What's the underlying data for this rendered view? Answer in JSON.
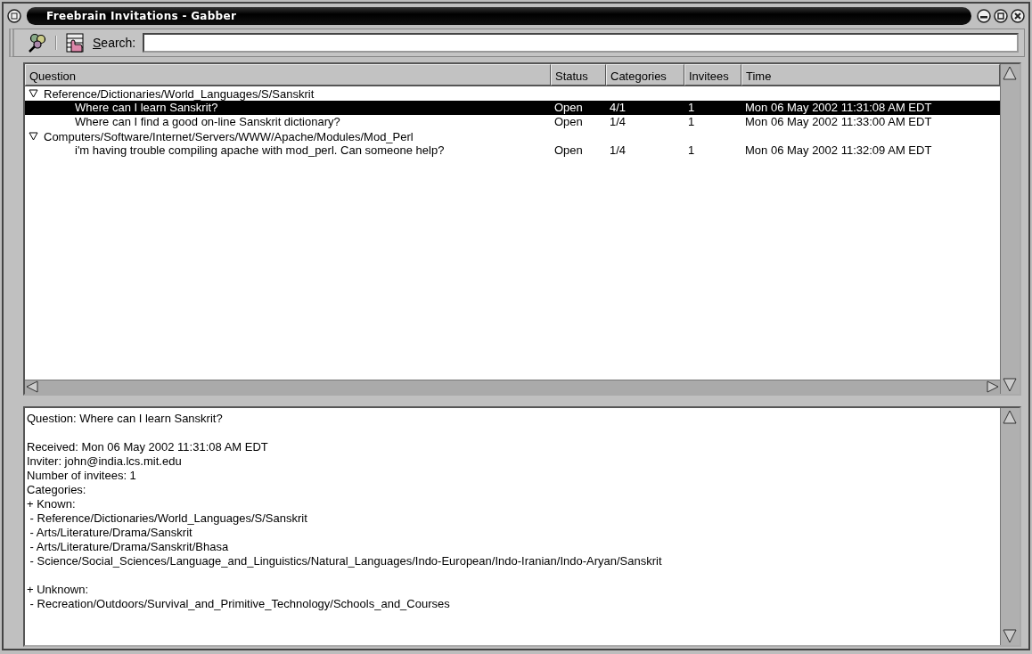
{
  "window": {
    "title": "Freebrain Invitations - Gabber"
  },
  "toolbar": {
    "search_label": "Search:"
  },
  "table": {
    "columns": [
      "Question",
      "Status",
      "Categories",
      "Invitees",
      "Time"
    ],
    "groups": [
      {
        "category": "Reference/Dictionaries/World_Languages/S/Sanskrit",
        "expanded": true,
        "rows": [
          {
            "question": "Where can I learn Sanskrit?",
            "status": "Open",
            "categories": "4/1",
            "invitees": "1",
            "time": "Mon 06 May 2002 11:31:08 AM EDT",
            "selected": true
          },
          {
            "question": "Where can I find a good on-line Sanskrit dictionary?",
            "status": "Open",
            "categories": "1/4",
            "invitees": "1",
            "time": "Mon 06 May 2002 11:33:00 AM EDT",
            "selected": false
          }
        ]
      },
      {
        "category": "Computers/Software/Internet/Servers/WWW/Apache/Modules/Mod_Perl",
        "expanded": true,
        "rows": [
          {
            "question": "i'm having trouble compiling apache with mod_perl. Can someone help?",
            "status": "Open",
            "categories": "1/4",
            "invitees": "1",
            "time": "Mon 06 May 2002 11:32:09 AM EDT",
            "selected": false
          }
        ]
      }
    ]
  },
  "details": {
    "paragraphs": [
      [
        "Question: Where can I learn Sanskrit?"
      ],
      [
        "Received: Mon 06 May 2002 11:31:08 AM EDT",
        "Inviter: john@india.lcs.mit.edu",
        "Number of invitees: 1",
        "Categories:",
        "+ Known:",
        " - Reference/Dictionaries/World_Languages/S/Sanskrit",
        " - Arts/Literature/Drama/Sanskrit",
        " - Arts/Literature/Drama/Sanskrit/Bhasa",
        " - Science/Social_Sciences/Language_and_Linguistics/Natural_Languages/Indo-European/Indo-Iranian/Indo-Aryan/Sanskrit"
      ],
      [
        "+ Unknown:",
        " - Recreation/Outdoors/Survival_and_Primitive_Technology/Schools_and_Courses"
      ]
    ]
  }
}
